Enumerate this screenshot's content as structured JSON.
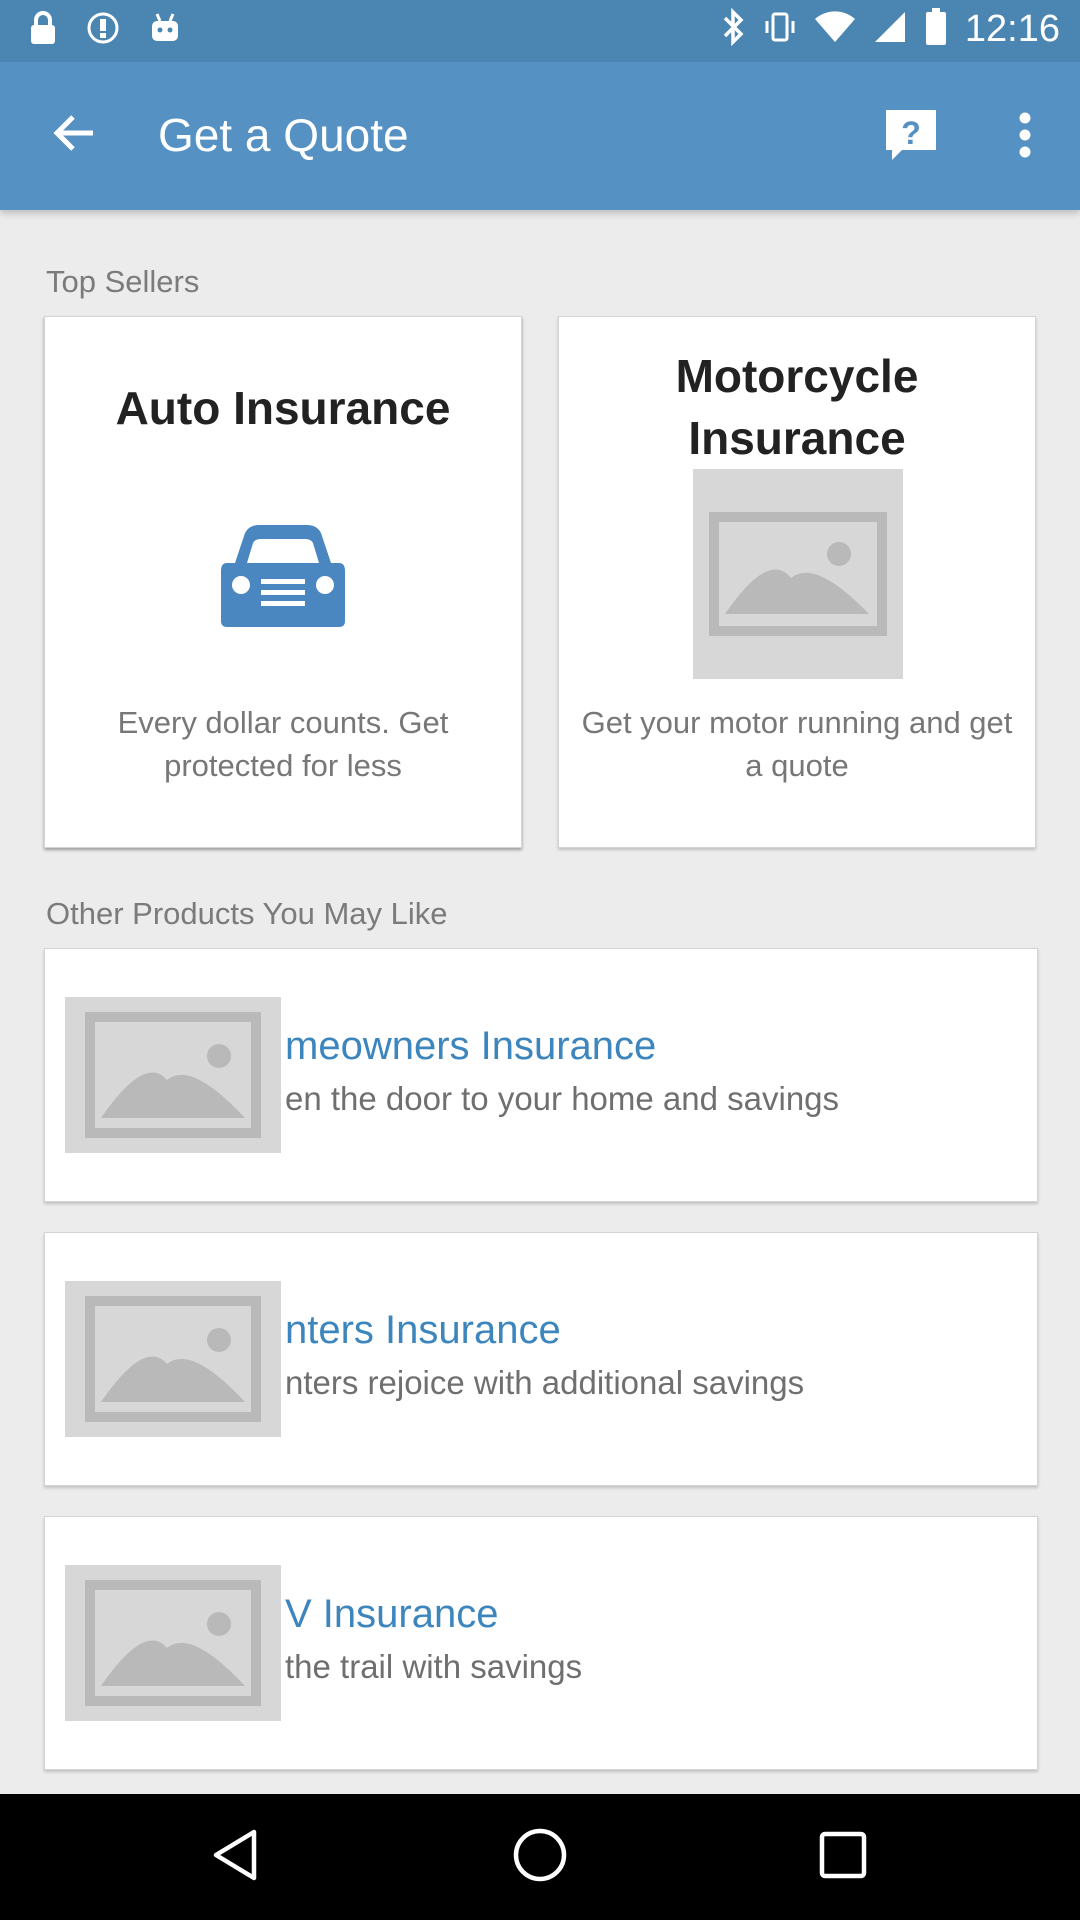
{
  "status_bar": {
    "time": "12:16",
    "left_icons": [
      "lock-icon",
      "alert-icon",
      "android-icon"
    ],
    "right_icons": [
      "bluetooth-icon",
      "vibrate-icon",
      "wifi-icon",
      "signal-icon",
      "battery-icon"
    ]
  },
  "app_bar": {
    "title": "Get a Quote",
    "back_icon": "arrow-back-icon",
    "help_icon": "help-icon",
    "more_icon": "more-vert-icon"
  },
  "top_sellers": {
    "label": "Top Sellers",
    "cards": [
      {
        "title": "Auto Insurance",
        "description": "Every dollar counts. Get protected for less",
        "icon": "car-icon"
      },
      {
        "title": "Motorcycle Insurance",
        "description": "Get your motor running and get a quote",
        "icon": "image-placeholder-icon"
      }
    ]
  },
  "other_products": {
    "label": "Other Products You May Like",
    "items": [
      {
        "title": "meowners Insurance",
        "subtitle": "en the door to your home and savings",
        "icon": "image-placeholder-icon"
      },
      {
        "title": "nters Insurance",
        "subtitle": "nters rejoice with additional savings",
        "icon": "image-placeholder-icon"
      },
      {
        "title": "V Insurance",
        "subtitle": "the trail with savings",
        "icon": "image-placeholder-icon"
      }
    ]
  },
  "nav_bar": {
    "buttons": [
      "back-triangle-icon",
      "home-circle-icon",
      "recents-square-icon"
    ]
  },
  "colors": {
    "app_bar": "#5591c2",
    "status_bar": "#4b86b3",
    "accent": "#3c86bd",
    "card_icon": "#4a86bf"
  }
}
